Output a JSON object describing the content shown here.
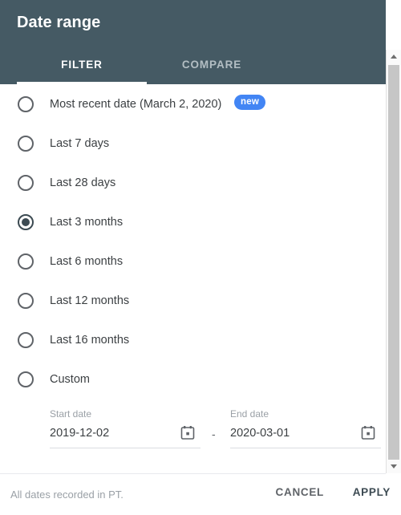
{
  "dialog": {
    "title": "Date range"
  },
  "tabs": [
    {
      "label": "FILTER",
      "active": true
    },
    {
      "label": "COMPARE",
      "active": false
    }
  ],
  "options": [
    {
      "label": "Most recent date (March 2, 2020)",
      "selected": false,
      "badge": "new"
    },
    {
      "label": "Last 7 days",
      "selected": false
    },
    {
      "label": "Last 28 days",
      "selected": false
    },
    {
      "label": "Last 3 months",
      "selected": true
    },
    {
      "label": "Last 6 months",
      "selected": false
    },
    {
      "label": "Last 12 months",
      "selected": false
    },
    {
      "label": "Last 16 months",
      "selected": false
    },
    {
      "label": "Custom",
      "selected": false
    }
  ],
  "custom_range": {
    "start": {
      "caption": "Start date",
      "value": "2019-12-02",
      "calendar_icon": "calendar-icon"
    },
    "separator": "-",
    "end": {
      "caption": "End date",
      "value": "2020-03-01",
      "calendar_icon": "calendar-icon"
    }
  },
  "footer": {
    "note": "All dates recorded in PT.",
    "cancel_label": "CANCEL",
    "apply_label": "APPLY"
  },
  "scrollbar": {
    "up_icon": "triangle-up-icon",
    "down_icon": "triangle-down-icon"
  },
  "colors": {
    "header_bg": "#455A64",
    "badge_bg": "#4285F4",
    "accent": "#3C4A52",
    "text": "#3C4043",
    "muted": "#9AA0A6"
  }
}
